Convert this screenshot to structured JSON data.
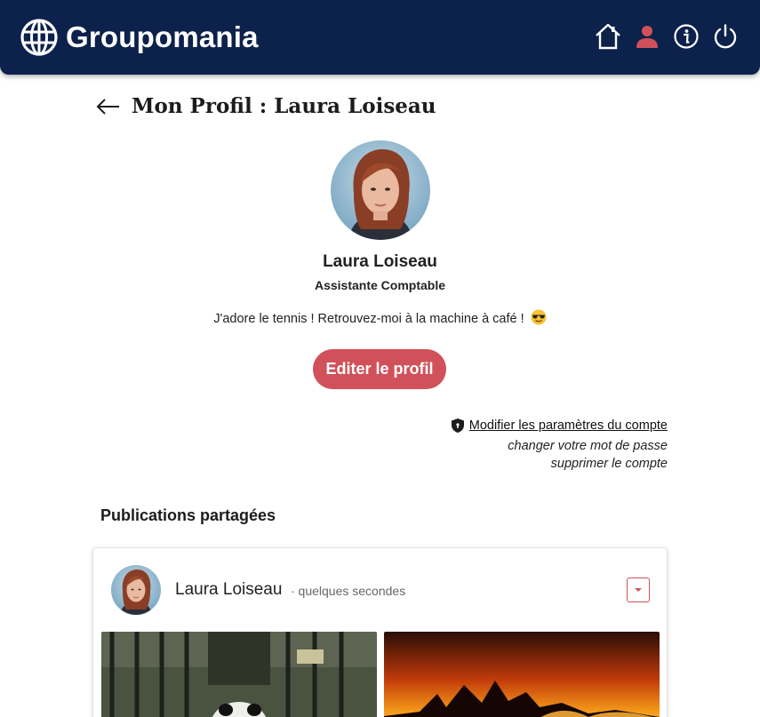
{
  "navbar": {
    "brand": "Groupomania",
    "icons": [
      "globe-icon",
      "home-icon",
      "user-icon",
      "info-icon",
      "power-icon"
    ],
    "background": "#0c214b",
    "active_icon_color": "#d1515a"
  },
  "page": {
    "title": "Mon Profil : Laura Loiseau"
  },
  "profile": {
    "name": "Laura Loiseau",
    "job": "Assistante Comptable",
    "bio": "J'adore le tennis ! Retrouvez-moi à la machine à café !",
    "edit_button": "Editer le profil"
  },
  "account": {
    "settings_link": "Modifier les paramètres du compte",
    "change_password": "changer votre mot de passe",
    "delete_account": "supprimer le compte"
  },
  "publications": {
    "section_title": "Publications partagées",
    "posts": [
      {
        "author": "Laura Loiseau",
        "time": "· quelques secondes",
        "images": [
          "panda-image",
          "forest-fire-image"
        ]
      }
    ]
  },
  "colors": {
    "accent": "#d1515a",
    "navy": "#0c214b"
  }
}
